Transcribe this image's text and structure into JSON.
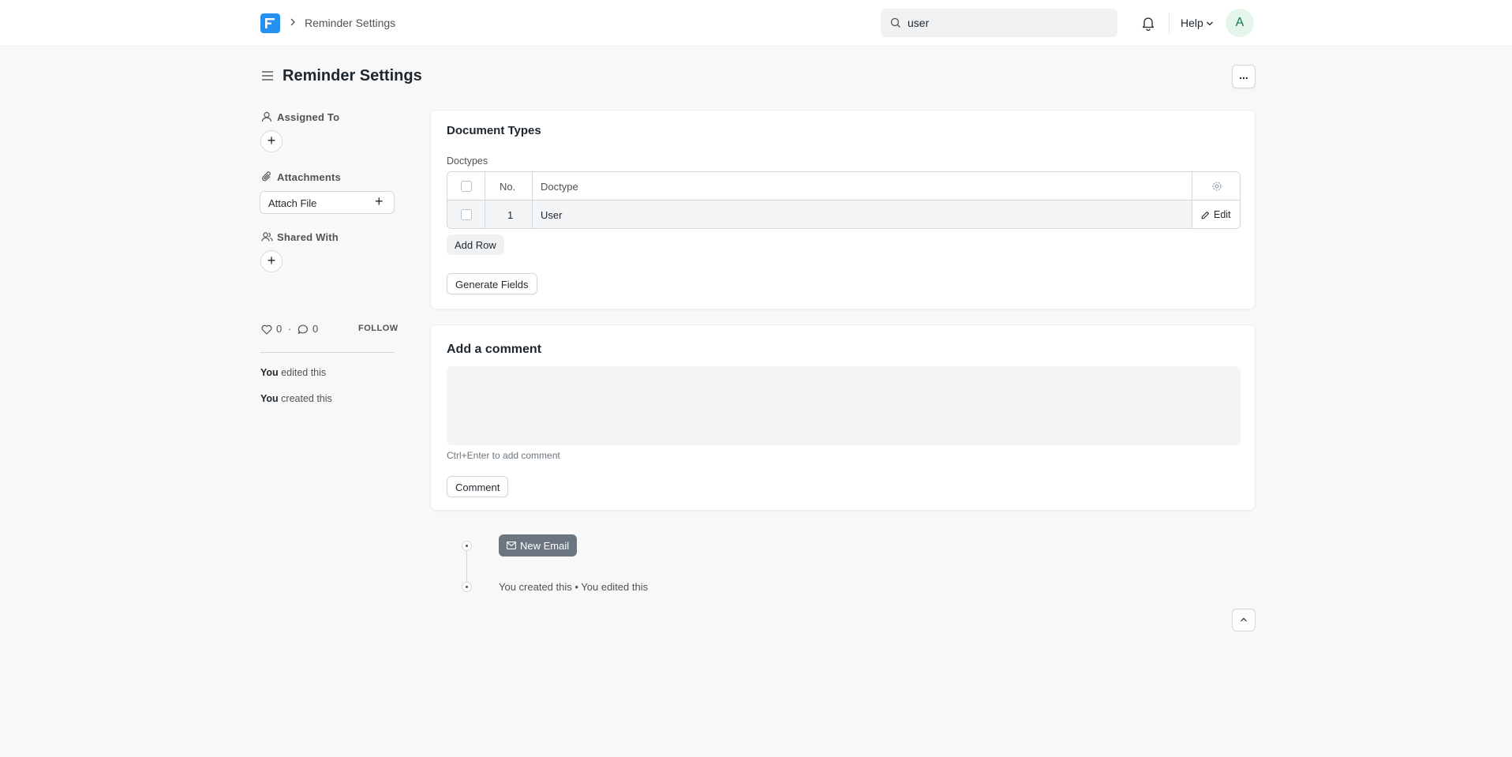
{
  "navbar": {
    "breadcrumb": "Reminder Settings",
    "search_value": "user",
    "help_label": "Help",
    "avatar_initial": "A"
  },
  "page": {
    "title": "Reminder Settings",
    "more_label": "..."
  },
  "sidebar": {
    "assigned_to_label": "Assigned To",
    "attachments_label": "Attachments",
    "attach_file_label": "Attach File",
    "shared_with_label": "Shared With",
    "likes_count": "0",
    "comments_count": "0",
    "separator": "·",
    "follow_label": "FOLLOW",
    "activity": [
      {
        "actor": "You",
        "action": "edited this"
      },
      {
        "actor": "You",
        "action": "created this"
      }
    ]
  },
  "document_types": {
    "section_title": "Document Types",
    "table_label": "Doctypes",
    "columns": [
      "No.",
      "Doctype"
    ],
    "rows": [
      {
        "no": "1",
        "doctype": "User"
      }
    ],
    "edit_label": "Edit",
    "add_row_label": "Add Row",
    "generate_fields_label": "Generate Fields"
  },
  "comment": {
    "title": "Add a comment",
    "hint": "Ctrl+Enter to add comment",
    "button_label": "Comment"
  },
  "timeline": {
    "new_email_label": "New Email",
    "summary": "You created this • You edited this"
  }
}
